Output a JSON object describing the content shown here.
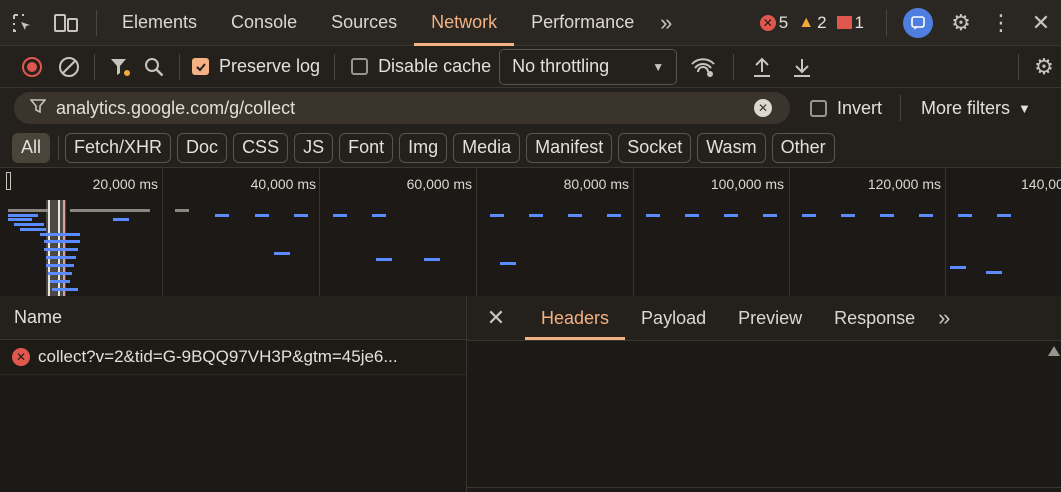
{
  "tabs": [
    "Elements",
    "Console",
    "Sources",
    "Network",
    "Performance"
  ],
  "badges": {
    "errors": "5",
    "warnings": "2",
    "issues": "1"
  },
  "toolbar": {
    "preserve_log": "Preserve log",
    "disable_cache": "Disable cache",
    "throttling": "No throttling"
  },
  "filter": {
    "value": "analytics.google.com/g/collect",
    "invert": "Invert",
    "more_filters": "More filters"
  },
  "chips": [
    "All",
    "Fetch/XHR",
    "Doc",
    "CSS",
    "JS",
    "Font",
    "Img",
    "Media",
    "Manifest",
    "Socket",
    "Wasm",
    "Other"
  ],
  "overview": {
    "ticks": [
      "20,000 ms",
      "40,000 ms",
      "60,000 ms",
      "80,000 ms",
      "100,000 ms",
      "120,000 ms",
      "140,00"
    ]
  },
  "requests": {
    "header": "Name",
    "rows": [
      {
        "name": "collect?v=2&tid=G-9BQQ97VH3P&gtm=45je6..."
      }
    ]
  },
  "detail": {
    "tabs": [
      "Headers",
      "Payload",
      "Preview",
      "Response"
    ]
  },
  "colors": {
    "accent": "#f4b183",
    "error": "#e0574e",
    "warning": "#f2a93b",
    "bar": "#5b8cff",
    "assistant": "#4e7fe0"
  }
}
